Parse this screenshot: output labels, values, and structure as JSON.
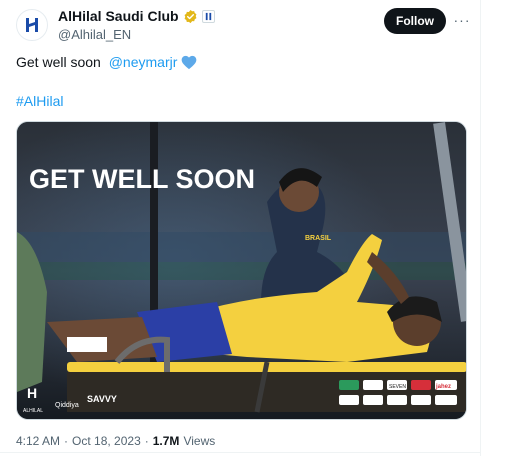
{
  "account": {
    "display_name": "AlHilal Saudi Club",
    "handle": "@Alhilal_EN"
  },
  "actions": {
    "follow_label": "Follow",
    "more_label": "···"
  },
  "tweet": {
    "text_prefix": "Get well soon ",
    "mention": "@neymarjr",
    "hashtag": "#AlHilal"
  },
  "media": {
    "headline": "GET WELL SOON",
    "jersey_text": "BRASIL",
    "sponsor_logos": [
      "ALHILAL",
      "Qiddiya",
      "SAVVY",
      "jahez",
      "SEVEN"
    ]
  },
  "meta": {
    "time": "4:12 AM",
    "sep1": "·",
    "date": "Oct 18, 2023",
    "sep2": "·",
    "views_count": "1.7M",
    "views_label": "Views"
  },
  "colors": {
    "accent": "#1d9bf0",
    "verified_gold": "#e2b719",
    "heart_blue": "#5da9e9"
  }
}
